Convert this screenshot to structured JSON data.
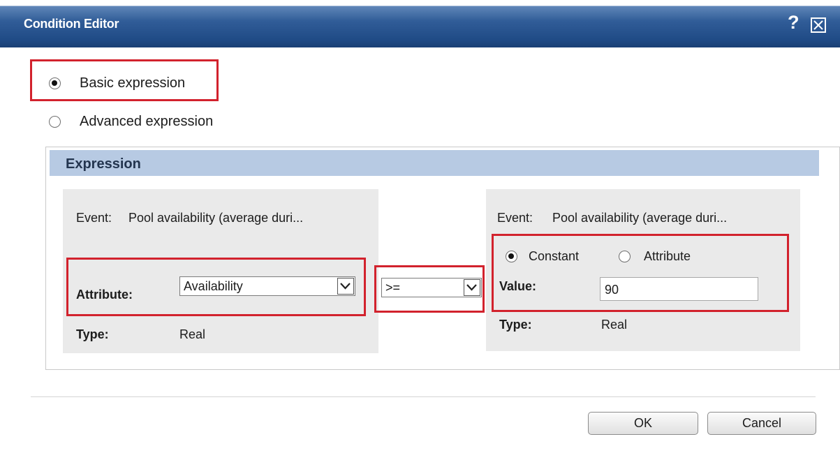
{
  "dialog": {
    "title": "Condition Editor",
    "help_icon": "?",
    "close_icon": "close-icon"
  },
  "mode": {
    "basic_label": "Basic expression",
    "advanced_label": "Advanced expression",
    "selected": "basic"
  },
  "expression": {
    "header": "Expression",
    "left": {
      "event_label": "Event:",
      "event_value": "Pool availability (average duri...",
      "attribute_label": "Attribute:",
      "attribute_value": "Availability",
      "type_label": "Type:",
      "type_value": "Real"
    },
    "operator": ">=",
    "right": {
      "event_label": "Event:",
      "event_value": "Pool availability (average duri...",
      "constant_label": "Constant",
      "attribute_option_label": "Attribute",
      "selected": "constant",
      "value_label": "Value:",
      "value": "90",
      "type_label": "Type:",
      "type_value": "Real"
    }
  },
  "buttons": {
    "ok": "OK",
    "cancel": "Cancel"
  },
  "colors": {
    "titlebar": "#1f4a85",
    "section_header": "#b7cae3",
    "highlight": "#d2222d"
  }
}
